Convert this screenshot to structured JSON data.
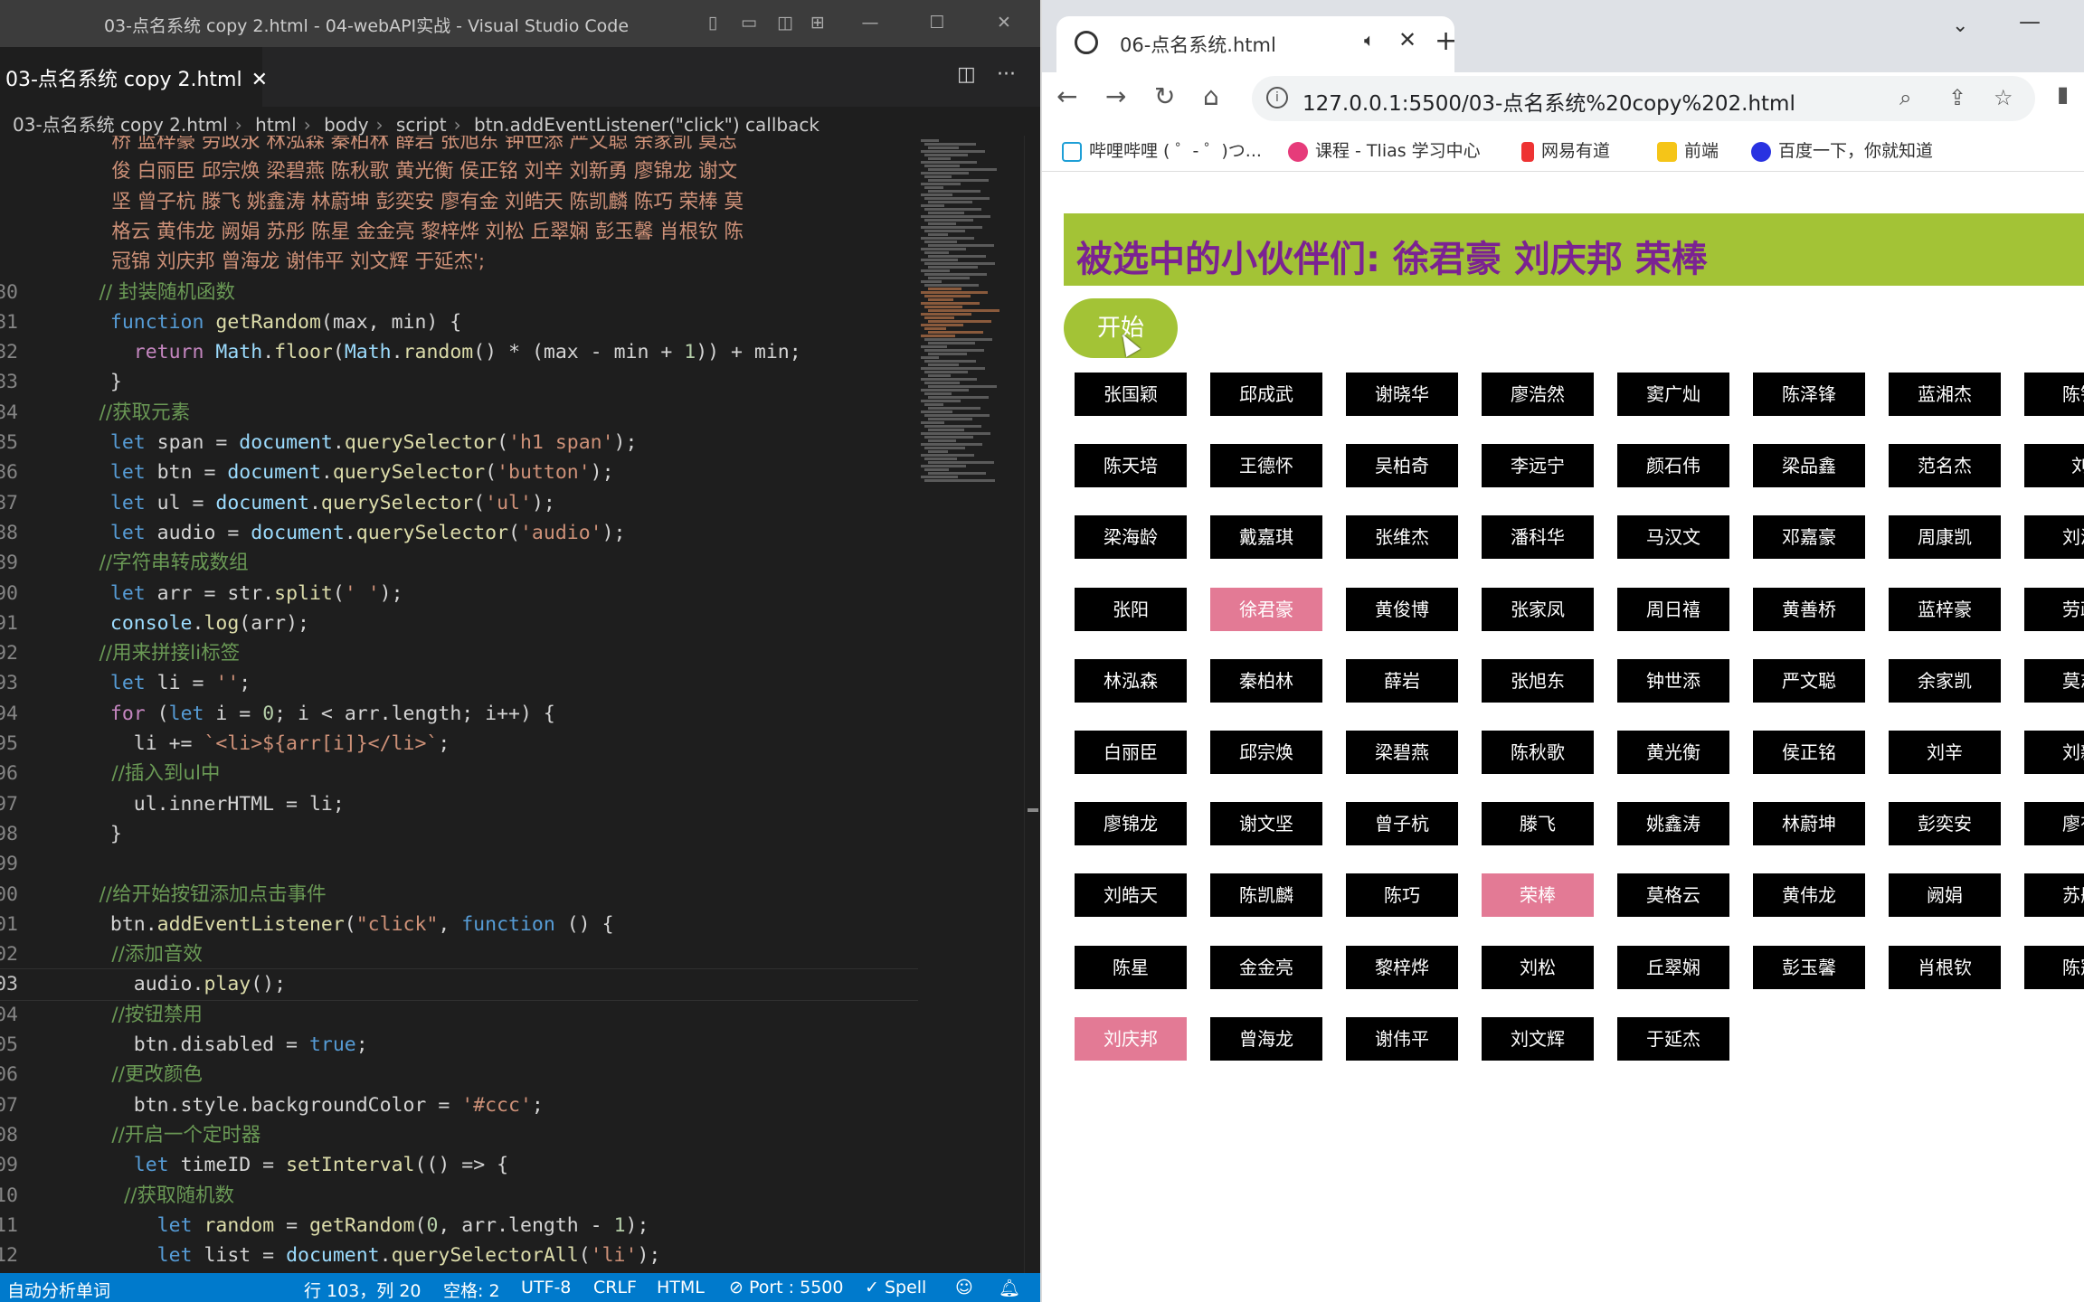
{
  "vscode": {
    "title": "03-点名系统 copy 2.html - 04-webAPI实战 - Visual Studio Code",
    "tab_label": "03-点名系统 copy 2.html",
    "breadcrumb": [
      "03-点名系统 copy 2.html",
      "html",
      "body",
      "script",
      "btn.addEventListener(\"click\") callback"
    ],
    "status": {
      "left": "自动分析单词",
      "position": "行 103，列 20",
      "spaces": "空格: 2",
      "encoding": "UTF-8",
      "eol": "CRLF",
      "lang": "HTML",
      "port": "Port : 5500",
      "spell": "✓ Spell"
    },
    "code_lines": [
      {
        "n": "",
        "t": "    桥 蓝梓豪 劳政永 林泓森 秦柏林 薛岩 张旭东 钟世添 严文聪 余家凯 莫志"
      },
      {
        "n": "",
        "t": "    俊 白丽臣 邱宗焕 梁碧燕 陈秋歌 黄光衡 侯正铭 刘辛 刘新勇 廖锦龙 谢文"
      },
      {
        "n": "",
        "t": "    坚 曾子杭 滕飞 姚鑫涛 林蔚坤 彭奕安 廖有金 刘皓天 陈凯麟 陈巧 荣棒 莫"
      },
      {
        "n": "",
        "t": "    格云 黄伟龙 阙娟 苏彤 陈星 金金亮 黎梓烨 刘松 丘翠娴 彭玉馨 肖根钦 陈"
      },
      {
        "n": "",
        "t": "    冠锦 刘庆邦 曾海龙 谢伟平 刘文辉 于延杰';"
      },
      {
        "n": "80",
        "t": "  // 封装随机函数"
      },
      {
        "n": "81",
        "t": "  function getRandom(max, min) {"
      },
      {
        "n": "82",
        "t": "    return Math.floor(Math.random() * (max - min + 1)) + min;"
      },
      {
        "n": "83",
        "t": "  }"
      },
      {
        "n": "84",
        "t": "  //获取元素"
      },
      {
        "n": "85",
        "t": "  let span = document.querySelector('h1 span');"
      },
      {
        "n": "86",
        "t": "  let btn = document.querySelector('button');"
      },
      {
        "n": "87",
        "t": "  let ul = document.querySelector('ul');"
      },
      {
        "n": "88",
        "t": "  let audio = document.querySelector('audio');"
      },
      {
        "n": "89",
        "t": "  //字符串转成数组"
      },
      {
        "n": "90",
        "t": "  let arr = str.split(' ');"
      },
      {
        "n": "91",
        "t": "  console.log(arr);"
      },
      {
        "n": "92",
        "t": "  //用来拼接li标签"
      },
      {
        "n": "93",
        "t": "  let li = '';"
      },
      {
        "n": "94",
        "t": "  for (let i = 0; i < arr.length; i++) {"
      },
      {
        "n": "95",
        "t": "    li += `<li>${arr[i]}</li>`;"
      },
      {
        "n": "96",
        "t": "    //插入到ul中"
      },
      {
        "n": "97",
        "t": "    ul.innerHTML = li;"
      },
      {
        "n": "98",
        "t": "  }"
      },
      {
        "n": "99",
        "t": ""
      },
      {
        "n": "00",
        "t": "  //给开始按钮添加点击事件"
      },
      {
        "n": "01",
        "t": "  btn.addEventListener(\"click\", function () {"
      },
      {
        "n": "02",
        "t": "    //添加音效"
      },
      {
        "n": "03",
        "t": "    audio.play();"
      },
      {
        "n": "04",
        "t": "    //按钮禁用"
      },
      {
        "n": "05",
        "t": "    btn.disabled = true;"
      },
      {
        "n": "06",
        "t": "    //更改颜色"
      },
      {
        "n": "07",
        "t": "    btn.style.backgroundColor = '#ccc';"
      },
      {
        "n": "08",
        "t": "    //开启一个定时器"
      },
      {
        "n": "09",
        "t": "    let timeID = setInterval(() => {"
      },
      {
        "n": "10",
        "t": "      //获取随机数"
      },
      {
        "n": "11",
        "t": "      let random = getRandom(0, arr.length - 1);"
      },
      {
        "n": "12",
        "t": "      let list = document.querySelectorAll('li');"
      }
    ]
  },
  "browser": {
    "tab_title": "06-点名系统.html",
    "url": "127.0.0.1:5500/03-点名系统%20copy%202.html",
    "bookmarks": [
      "哔哩哔哩 ( ゜- ゜)つ...",
      "课程 - Tlias 学习中心",
      "网易有道",
      "前端",
      "百度一下，你就知道"
    ],
    "heading": "被选中的小伙伴们: 徐君豪 刘庆邦 荣棒",
    "start_button": "开始",
    "names": [
      [
        "张国颖",
        "邱成武",
        "谢晓华",
        "廖浩然",
        "窦广灿",
        "陈泽锋",
        "蓝湘杰",
        "陈锦"
      ],
      [
        "陈天培",
        "王德怀",
        "吴柏奇",
        "李远宁",
        "颜石伟",
        "梁品鑫",
        "范名杰",
        "刘"
      ],
      [
        "梁海龄",
        "戴嘉琪",
        "张维杰",
        "潘科华",
        "马汉文",
        "邓嘉豪",
        "周康凯",
        "刘泽"
      ],
      [
        "张阳",
        "徐君豪",
        "黄俊博",
        "张家凤",
        "周日禧",
        "黄善桥",
        "蓝梓豪",
        "劳政"
      ],
      [
        "林泓森",
        "秦柏林",
        "薛岩",
        "张旭东",
        "钟世添",
        "严文聪",
        "余家凯",
        "莫志"
      ],
      [
        "白丽臣",
        "邱宗焕",
        "梁碧燕",
        "陈秋歌",
        "黄光衡",
        "侯正铭",
        "刘辛",
        "刘新"
      ],
      [
        "廖锦龙",
        "谢文坚",
        "曾子杭",
        "滕飞",
        "姚鑫涛",
        "林蔚坤",
        "彭奕安",
        "廖有"
      ],
      [
        "刘皓天",
        "陈凯麟",
        "陈巧",
        "荣棒",
        "莫格云",
        "黄伟龙",
        "阙娟",
        "苏彤"
      ],
      [
        "陈星",
        "金金亮",
        "黎梓烨",
        "刘松",
        "丘翠娴",
        "彭玉馨",
        "肖根钦",
        "陈冠"
      ],
      [
        "刘庆邦",
        "曾海龙",
        "谢伟平",
        "刘文辉",
        "于延杰"
      ]
    ],
    "selected": [
      "徐君豪",
      "荣棒",
      "刘庆邦"
    ],
    "colors": {
      "accent": "#a3c336",
      "heading_text": "#7b2292",
      "selected": "#e37a95",
      "item": "#000000"
    }
  }
}
